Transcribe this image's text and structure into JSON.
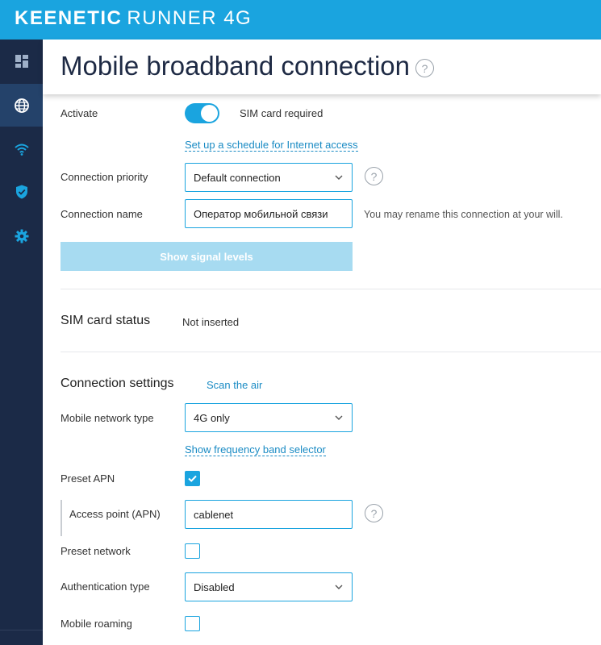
{
  "brand": {
    "name_bold": "KEENETIC",
    "name_model": "RUNNER 4G"
  },
  "sidebar": {
    "items": [
      {
        "icon": "dashboard-icon",
        "active": false
      },
      {
        "icon": "globe-icon",
        "active": true
      },
      {
        "icon": "wifi-icon",
        "active": false
      },
      {
        "icon": "shield-icon",
        "active": false
      },
      {
        "icon": "gear-icon",
        "active": false
      }
    ]
  },
  "header": {
    "title": "Mobile broadband connection",
    "help": "?"
  },
  "form": {
    "activate_label": "Activate",
    "activate_on": true,
    "sim_required": "SIM card required",
    "schedule_link": "Set up a schedule for Internet access",
    "priority_label": "Connection priority",
    "priority_value": "Default connection",
    "priority_help": "?",
    "name_label": "Connection name",
    "name_value": "Оператор мобильной связи",
    "name_hint": "You may rename this connection at your will.",
    "signal_button": "Show signal levels"
  },
  "sim_status": {
    "title": "SIM card status",
    "value": "Not inserted"
  },
  "conn_settings": {
    "title": "Connection settings",
    "scan_link": "Scan the air",
    "network_type_label": "Mobile network type",
    "network_type_value": "4G only",
    "freq_link": "Show frequency band selector",
    "preset_apn_label": "Preset APN",
    "preset_apn_checked": true,
    "apn_label": "Access point (APN)",
    "apn_value": "cablenet",
    "apn_help": "?",
    "preset_network_label": "Preset network",
    "preset_network_checked": false,
    "auth_label": "Authentication type",
    "auth_value": "Disabled",
    "roaming_label": "Mobile roaming",
    "roaming_checked": false
  },
  "colors": {
    "accent": "#1aa4df",
    "sidebar": "#1b2a47",
    "sidebar_active": "#24426a",
    "link": "#1a8bc4",
    "button_disabled": "#a7dbf1"
  }
}
